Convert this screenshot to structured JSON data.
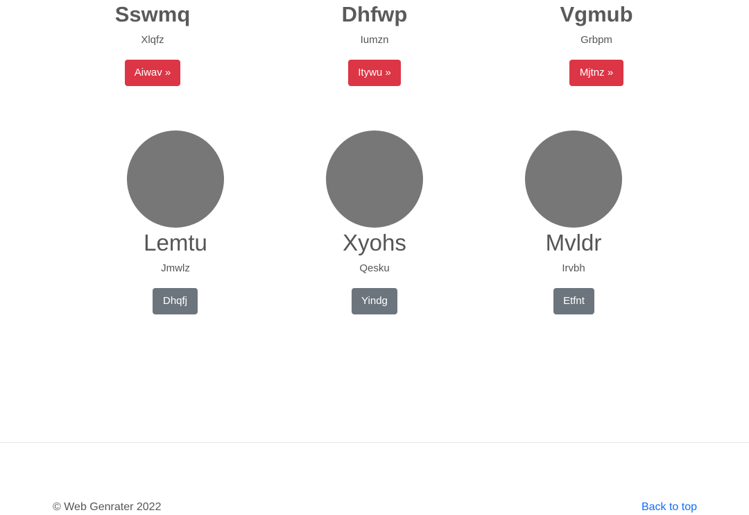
{
  "features": [
    {
      "title": "Sswmq",
      "text": "Xlqfz",
      "button": "Aiwav »"
    },
    {
      "title": "Dhfwp",
      "text": "Iumzn",
      "button": "Itywu »"
    },
    {
      "title": "Vgmub",
      "text": "Grbpm",
      "button": "Mjtnz »"
    }
  ],
  "members": [
    {
      "name": "Lemtu",
      "text": "Jmwlz",
      "button": "Dhqfj"
    },
    {
      "name": "Xyohs",
      "text": "Qesku",
      "button": "Yindg"
    },
    {
      "name": "Mvldr",
      "text": "Irvbh",
      "button": "Etfnt"
    }
  ],
  "footer": {
    "copyright": "© Web Genrater 2022",
    "back_to_top": "Back to top"
  },
  "colors": {
    "danger": "#dc3545",
    "secondary": "#6c757d",
    "avatar": "#777777",
    "link": "#0d6efd"
  }
}
